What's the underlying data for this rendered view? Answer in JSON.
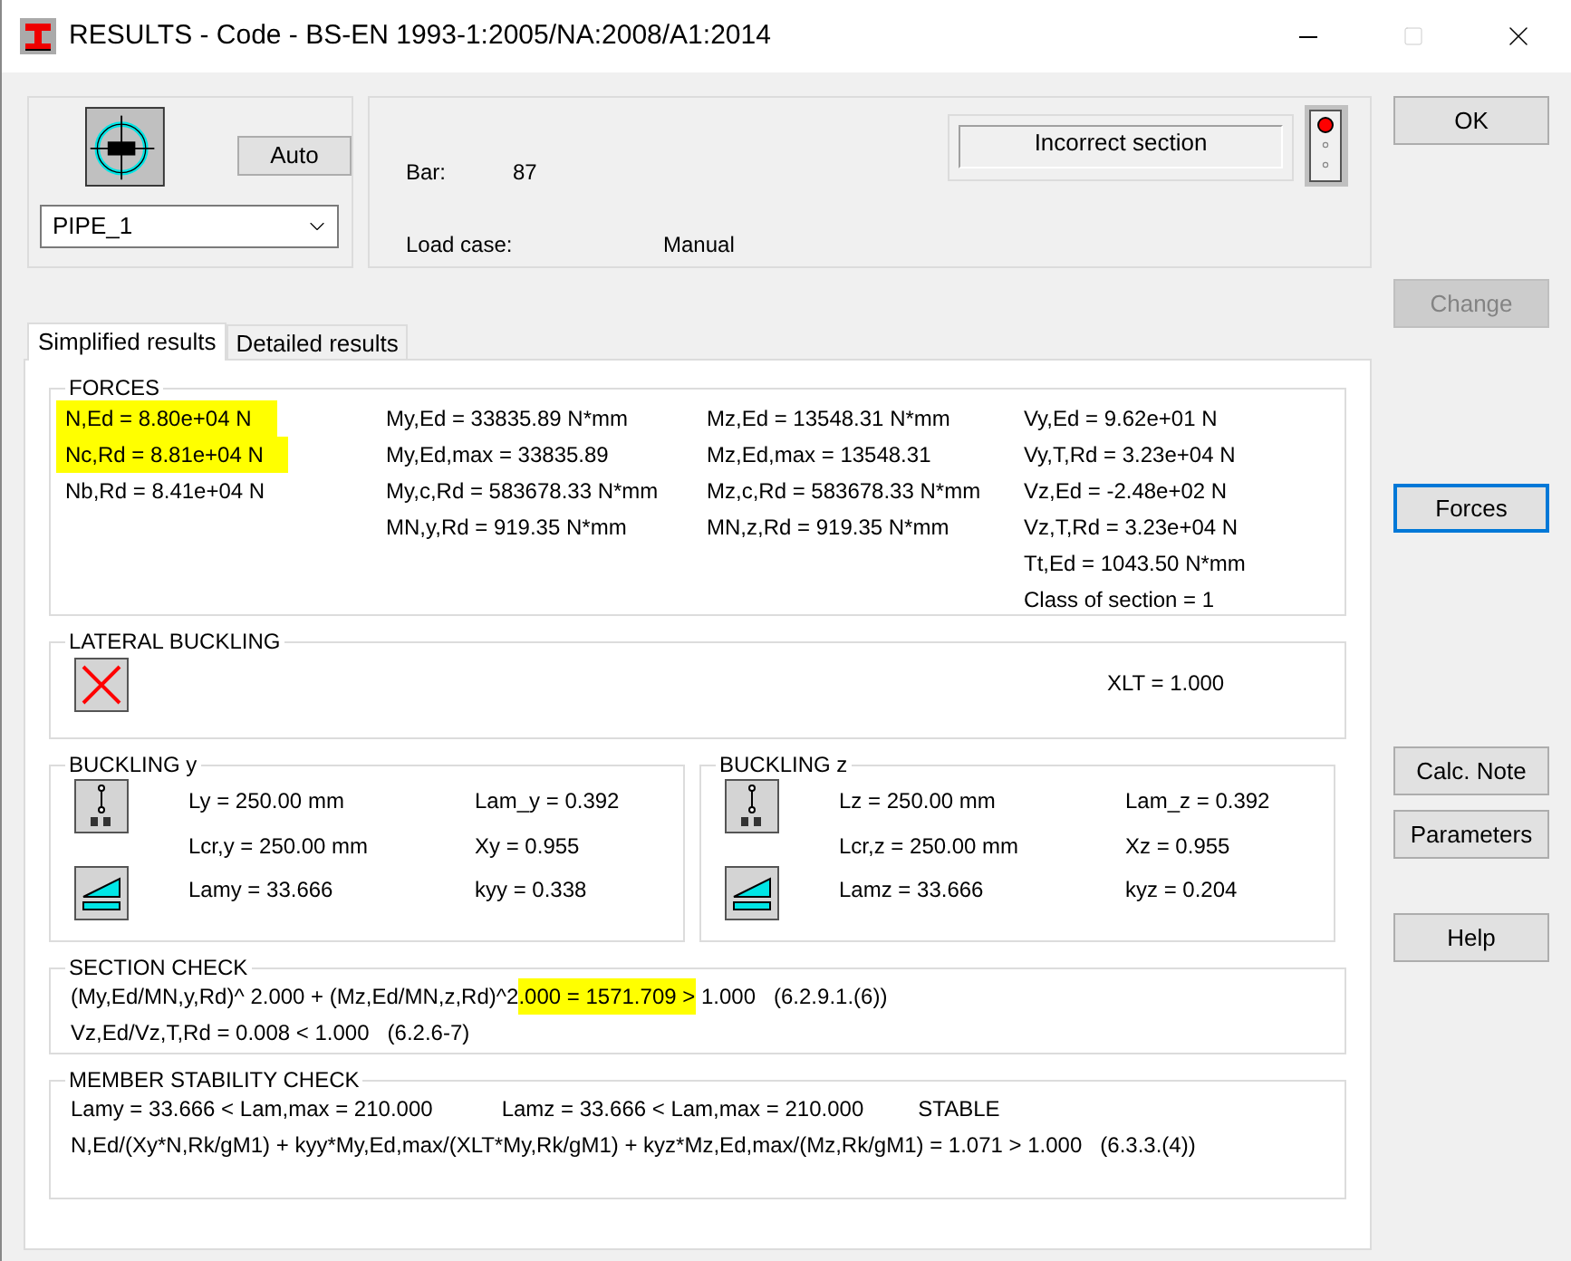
{
  "window": {
    "title": "RESULTS - Code - BS-EN 1993-1:2005/NA:2008/A1:2014"
  },
  "section": {
    "auto_button": "Auto",
    "profile": "PIPE_1"
  },
  "info": {
    "bar_label": "Bar:",
    "bar_value": "87",
    "load_case_label": "Load case:",
    "load_case_value": "Manual",
    "status": "Incorrect section",
    "lights": [
      {
        "on": true
      },
      {
        "on": false
      },
      {
        "on": false
      }
    ]
  },
  "buttons": [
    {
      "label": "OK",
      "disabled": false,
      "focused": false
    },
    {
      "label": "Change",
      "disabled": true,
      "focused": false
    },
    {
      "label": "Forces",
      "disabled": false,
      "focused": true
    },
    {
      "label": "Calc. Note",
      "disabled": false,
      "focused": false
    },
    {
      "label": "Parameters",
      "disabled": false,
      "focused": false
    },
    {
      "label": "Help",
      "disabled": false,
      "focused": false
    }
  ],
  "tabs": [
    {
      "label": "Simplified results",
      "selected": true
    },
    {
      "label": "Detailed results",
      "selected": false
    }
  ],
  "forces": {
    "title": "FORCES",
    "columns": [
      [
        {
          "text": "N,Ed = 8.80e+04 N",
          "highlighted": true
        },
        {
          "text": "Nc,Rd = 8.81e+04 N",
          "highlighted": true
        },
        {
          "text": "Nb,Rd = 8.41e+04 N",
          "highlighted": false
        }
      ],
      [
        {
          "text": "My,Ed = 33835.89 N*mm",
          "highlighted": false
        },
        {
          "text": "My,Ed,max = 33835.89",
          "highlighted": false
        },
        {
          "text": "My,c,Rd = 583678.33 N*mm",
          "highlighted": false
        },
        {
          "text": "MN,y,Rd = 919.35 N*mm",
          "highlighted": false
        }
      ],
      [
        {
          "text": "Mz,Ed = 13548.31 N*mm",
          "highlighted": false
        },
        {
          "text": "Mz,Ed,max = 13548.31",
          "highlighted": false
        },
        {
          "text": "Mz,c,Rd = 583678.33 N*mm",
          "highlighted": false
        },
        {
          "text": "MN,z,Rd = 919.35 N*mm",
          "highlighted": false
        }
      ],
      [
        {
          "text": "Vy,Ed = 9.62e+01 N",
          "highlighted": false
        },
        {
          "text": "Vy,T,Rd = 3.23e+04 N",
          "highlighted": false
        },
        {
          "text": "Vz,Ed = -2.48e+02 N",
          "highlighted": false
        },
        {
          "text": "Vz,T,Rd = 3.23e+04 N",
          "highlighted": false
        },
        {
          "text": "Tt,Ed = 1043.50 N*mm",
          "highlighted": false
        },
        {
          "text": "Class of section = 1",
          "highlighted": false
        }
      ]
    ]
  },
  "lateral_buckling": {
    "title": "LATERAL BUCKLING",
    "value": "XLT = 1.000"
  },
  "buckling": [
    {
      "title": "BUCKLING y",
      "values": [
        "Ly = 250.00 mm",
        "Lam_y = 0.392",
        "Lcr,y = 250.00 mm",
        "Xy = 0.955",
        "Lamy = 33.666",
        "kyy = 0.338"
      ]
    },
    {
      "title": "BUCKLING z",
      "values": [
        "Lz = 250.00 mm",
        "Lam_z = 0.392",
        "Lcr,z = 250.00 mm",
        "Xz = 0.955",
        "Lamz = 33.666",
        "kyz = 0.204"
      ]
    }
  ],
  "section_check": {
    "title": "SECTION CHECK",
    "lines": [
      [
        {
          "text": "(My,Ed/MN,y,Rd)^ 2.000 + (Mz,Ed/MN,z,Rd)^2",
          "highlighted": false
        },
        {
          "text": ".000 = 1571.709 >",
          "highlighted": true
        },
        {
          "text": " 1.000   (6.2.9.1.(6))",
          "highlighted": false
        }
      ],
      [
        {
          "text": "Vz,Ed/Vz,T,Rd = 0.008 < 1.000   (6.2.6-7)",
          "highlighted": false
        }
      ]
    ]
  },
  "member_stability": {
    "title": "MEMBER STABILITY CHECK",
    "lines": [
      [
        "Lamy = 33.666 < Lam,max = 210.000",
        "Lamz = 33.666 < Lam,max = 210.000",
        "STABLE"
      ],
      [
        "N,Ed/(Xy*N,Rk/gM1) + kyy*My,Ed,max/(XLT*My,Rk/gM1) + kyz*Mz,Ed,max/(Mz,Rk/gM1) = 1.071 > 1.000   (6.3.3.(4))"
      ]
    ]
  }
}
